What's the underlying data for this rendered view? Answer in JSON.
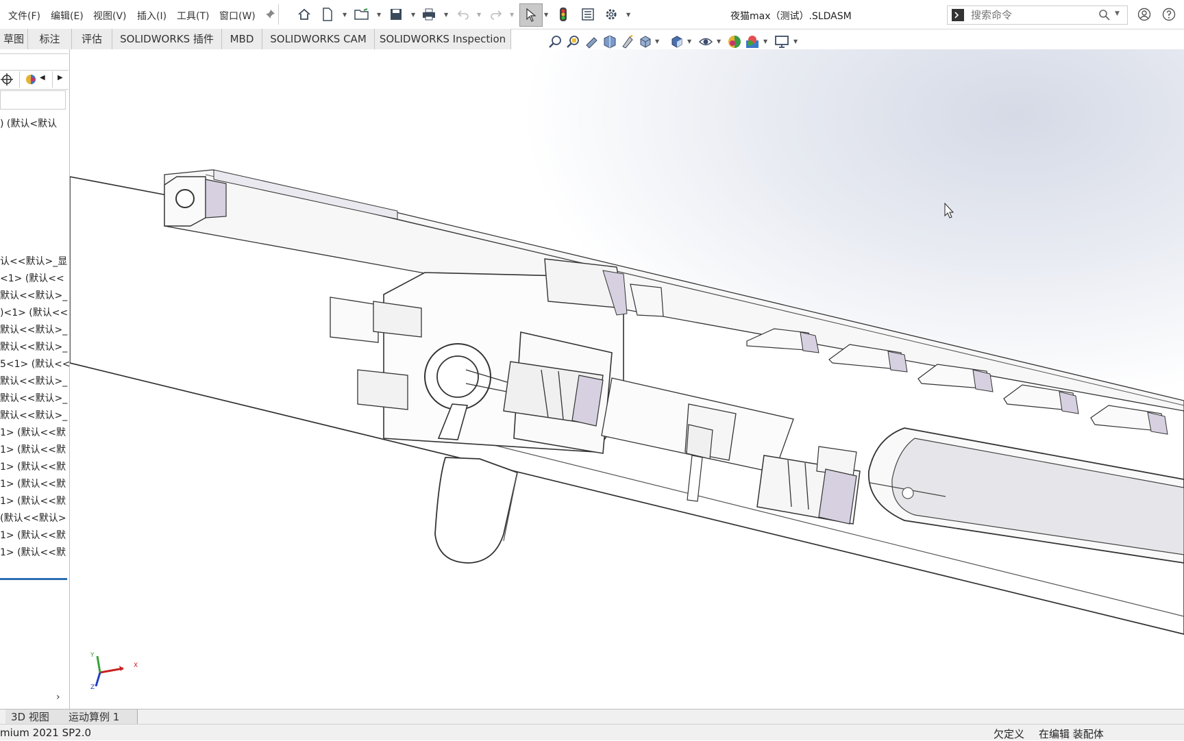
{
  "window": {
    "title": "夜猫max（测试）.SLDASM"
  },
  "menu": {
    "items": [
      "文件(F)",
      "编辑(E)",
      "视图(V)",
      "插入(I)",
      "工具(T)",
      "窗口(W)"
    ]
  },
  "search": {
    "placeholder": "搜索命令"
  },
  "tabs": [
    "草图",
    "标注",
    "评估",
    "SOLIDWORKS 插件",
    "MBD",
    "SOLIDWORKS CAM",
    "SOLIDWORKS Inspection"
  ],
  "tree": {
    "rows": [
      ")  (默认<默认",
      "认<<默认>_显",
      "<1> (默认<<",
      "默认<<默认>_",
      ")<1> (默认<<",
      "默认<<默认>_",
      "默认<<默认>_",
      "5<1> (默认<<",
      "默认<<默认>_",
      "默认<<默认>_",
      "默认<<默认>_",
      "1> (默认<<默",
      "1> (默认<<默",
      "1> (默认<<默",
      "1> (默认<<默",
      "1> (默认<<默",
      "(默认<<默认>",
      "1> (默认<<默",
      "1> (默认<<默"
    ]
  },
  "triad": {
    "x_label": "X",
    "y_label": "Y",
    "z_label": "Z"
  },
  "bottom_tabs": [
    "3D 视图",
    "运动算例 1"
  ],
  "status": {
    "version": "mium 2021 SP2.0",
    "definition": "欠定义",
    "mode": "在编辑 装配体"
  },
  "colors": {
    "accent": "#2b6cb0",
    "bg": "#ffffff"
  }
}
